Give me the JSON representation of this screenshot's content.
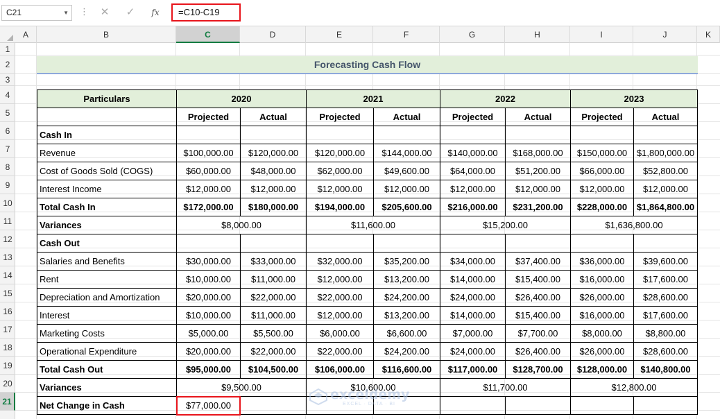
{
  "formula_bar": {
    "name_box": "C21",
    "cancel_glyph": "✕",
    "enter_glyph": "✓",
    "fx_label": "fx",
    "formula": "=C10-C19"
  },
  "columns": [
    "A",
    "B",
    "C",
    "D",
    "E",
    "F",
    "G",
    "H",
    "I",
    "J",
    "K"
  ],
  "selected_column": "C",
  "rows": [
    "1",
    "2",
    "3",
    "4",
    "5",
    "6",
    "7",
    "8",
    "9",
    "10",
    "11",
    "12",
    "13",
    "14",
    "15",
    "16",
    "17",
    "18",
    "19",
    "20",
    "21"
  ],
  "selected_row": "21",
  "sheet": {
    "title": "Forecasting Cash Flow",
    "header": {
      "particulars": "Particulars",
      "years": [
        "2020",
        "2021",
        "2022",
        "2023"
      ],
      "projected": "Projected",
      "actual": "Actual"
    },
    "sections": {
      "cash_in": "Cash In",
      "cash_out": "Cash Out"
    },
    "cash_in_rows": [
      {
        "label": "Revenue",
        "values": [
          "$100,000.00",
          "$120,000.00",
          "$120,000.00",
          "$144,000.00",
          "$140,000.00",
          "$168,000.00",
          "$150,000.00",
          "$1,800,000.00"
        ]
      },
      {
        "label": "Cost of Goods Sold (COGS)",
        "values": [
          "$60,000.00",
          "$48,000.00",
          "$62,000.00",
          "$49,600.00",
          "$64,000.00",
          "$51,200.00",
          "$66,000.00",
          "$52,800.00"
        ]
      },
      {
        "label": "Interest Income",
        "values": [
          "$12,000.00",
          "$12,000.00",
          "$12,000.00",
          "$12,000.00",
          "$12,000.00",
          "$12,000.00",
          "$12,000.00",
          "$12,000.00"
        ]
      }
    ],
    "total_cash_in": {
      "label": "Total Cash In",
      "values": [
        "$172,000.00",
        "$180,000.00",
        "$194,000.00",
        "$205,600.00",
        "$216,000.00",
        "$231,200.00",
        "$228,000.00",
        "$1,864,800.00"
      ]
    },
    "variances_in": {
      "label": "Variances",
      "values": [
        "$8,000.00",
        "$11,600.00",
        "$15,200.00",
        "$1,636,800.00"
      ]
    },
    "cash_out_rows": [
      {
        "label": "Salaries and Benefits",
        "values": [
          "$30,000.00",
          "$33,000.00",
          "$32,000.00",
          "$35,200.00",
          "$34,000.00",
          "$37,400.00",
          "$36,000.00",
          "$39,600.00"
        ]
      },
      {
        "label": "Rent",
        "values": [
          "$10,000.00",
          "$11,000.00",
          "$12,000.00",
          "$13,200.00",
          "$14,000.00",
          "$15,400.00",
          "$16,000.00",
          "$17,600.00"
        ]
      },
      {
        "label": "Depreciation and Amortization",
        "values": [
          "$20,000.00",
          "$22,000.00",
          "$22,000.00",
          "$24,200.00",
          "$24,000.00",
          "$26,400.00",
          "$26,000.00",
          "$28,600.00"
        ]
      },
      {
        "label": "Interest",
        "values": [
          "$10,000.00",
          "$11,000.00",
          "$12,000.00",
          "$13,200.00",
          "$14,000.00",
          "$15,400.00",
          "$16,000.00",
          "$17,600.00"
        ]
      },
      {
        "label": "Marketing Costs",
        "values": [
          "$5,000.00",
          "$5,500.00",
          "$6,000.00",
          "$6,600.00",
          "$7,000.00",
          "$7,700.00",
          "$8,000.00",
          "$8,800.00"
        ]
      },
      {
        "label": "Operational Expenditure",
        "values": [
          "$20,000.00",
          "$22,000.00",
          "$22,000.00",
          "$24,200.00",
          "$24,000.00",
          "$26,400.00",
          "$26,000.00",
          "$28,600.00"
        ]
      }
    ],
    "total_cash_out": {
      "label": "Total Cash Out",
      "values": [
        "$95,000.00",
        "$104,500.00",
        "$106,000.00",
        "$116,600.00",
        "$117,000.00",
        "$128,700.00",
        "$128,000.00",
        "$140,800.00"
      ]
    },
    "variances_out": {
      "label": "Variances",
      "values": [
        "$9,500.00",
        "$10,600.00",
        "$11,700.00",
        "$12,800.00"
      ]
    },
    "net_change": {
      "label": "Net Change in Cash",
      "value": "$77,000.00"
    }
  },
  "watermark": {
    "name": "exceldemy",
    "tagline": "EXCEL · DATA · BI"
  },
  "colors": {
    "header_fill": "#e2efda",
    "title_text": "#44546a",
    "highlight": "#e8141b",
    "selection": "#107c41"
  }
}
